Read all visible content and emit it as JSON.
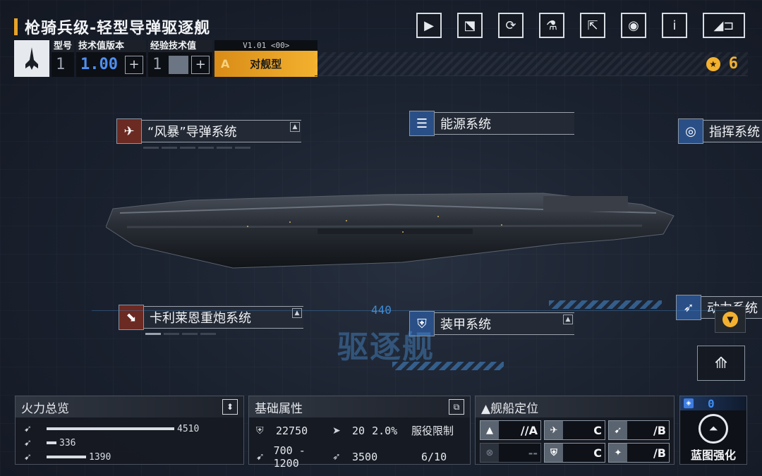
{
  "header": {
    "title": "枪骑兵级-轻型导弹驱逐舰",
    "toolbar": [
      {
        "name": "record-button",
        "icon": "video-camera-icon",
        "glyph": "▶"
      },
      {
        "name": "stats-button",
        "icon": "chart-icon",
        "glyph": "⬔"
      },
      {
        "name": "refresh-button",
        "icon": "refresh-icon",
        "glyph": "⟳"
      },
      {
        "name": "paint-button",
        "icon": "spray-paint-icon",
        "glyph": "⚗"
      },
      {
        "name": "share-button",
        "icon": "external-link-icon",
        "glyph": "⇱"
      },
      {
        "name": "view-button",
        "icon": "eye-icon",
        "glyph": "◉"
      },
      {
        "name": "info-button",
        "icon": "info-icon",
        "glyph": "i"
      },
      {
        "name": "back-button",
        "icon": "back-arrow-icon",
        "glyph": "◢⊐"
      }
    ]
  },
  "spec": {
    "model_label": "型号",
    "model_value": "1",
    "tech_label": "技术值版本",
    "tech_value": "1.00",
    "exp_label": "经验技术值",
    "exp_value": "1",
    "plus": "+",
    "version": "V1.01 <00>",
    "grade": "A",
    "class_name": "对舰型"
  },
  "currency": {
    "value": "6"
  },
  "systems": {
    "missile": "“风暴”导弹系统",
    "energy": "能源系统",
    "command": "指挥系统",
    "cannon": "卡利莱恩重炮系统",
    "armor": "装甲系统",
    "power": "动力系统"
  },
  "deco": {
    "number": "440",
    "ship_type": "驱逐舰"
  },
  "firepower": {
    "title": "火力总览",
    "rows": [
      {
        "value": "4510",
        "fill": 0.906
      },
      {
        "value": "336",
        "fill": 0.068
      },
      {
        "value": "1390",
        "fill": 0.279
      }
    ]
  },
  "attributes": {
    "title": "基础属性",
    "hp": "22750",
    "evade": "20",
    "evade_pct": "2.0%",
    "service_label": "服役限制",
    "range": "700 - 1200",
    "speed": "3500",
    "service_value": "6/10"
  },
  "positioning": {
    "title": "▲舰船定位",
    "cells": [
      {
        "grade": "//A",
        "icon": "▲",
        "dim": false
      },
      {
        "grade": "C",
        "icon": "✈",
        "dim": false
      },
      {
        "grade": "/B",
        "icon": "➹",
        "dim": false
      },
      {
        "grade": "--",
        "icon": "⊗",
        "dim": true
      },
      {
        "grade": "C",
        "icon": "⛨",
        "dim": false
      },
      {
        "grade": "/B",
        "icon": "✦",
        "dim": false
      }
    ]
  },
  "blueprint": {
    "count": "0",
    "label": "蓝图强化"
  },
  "colors": {
    "accent_orange": "#f3b12f",
    "accent_blue": "#3e8df0",
    "system_red": "#6b2a22",
    "system_blue": "#2a4f86"
  }
}
